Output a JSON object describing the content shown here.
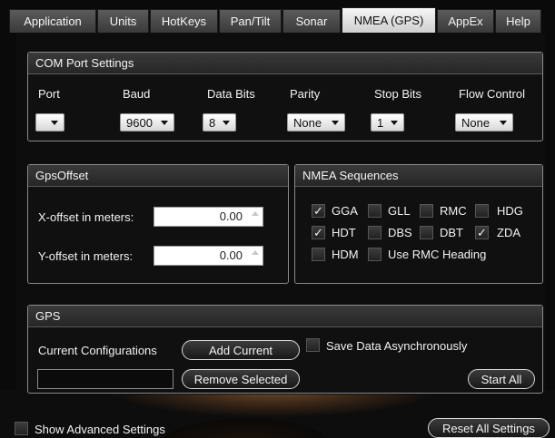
{
  "tabs": [
    {
      "label": "Application"
    },
    {
      "label": "Units"
    },
    {
      "label": "HotKeys"
    },
    {
      "label": "Pan/Tilt"
    },
    {
      "label": "Sonar"
    },
    {
      "label": "NMEA (GPS)",
      "active": true
    },
    {
      "label": "AppEx"
    },
    {
      "label": "Help"
    }
  ],
  "com": {
    "title": "COM Port Settings",
    "port_label": "Port",
    "port_value": "",
    "baud_label": "Baud",
    "baud_value": "9600",
    "databits_label": "Data Bits",
    "databits_value": "8",
    "parity_label": "Parity",
    "parity_value": "None",
    "stopbits_label": "Stop Bits",
    "stopbits_value": "1",
    "flow_label": "Flow Control",
    "flow_value": "None"
  },
  "offset": {
    "title": "GpsOffset",
    "x_label": "X-offset in meters:",
    "x_value": "0.00",
    "y_label": "Y-offset in meters:",
    "y_value": "0.00"
  },
  "nmea": {
    "title": "NMEA Sequences",
    "items": [
      {
        "label": "GGA",
        "checked": true
      },
      {
        "label": "GLL",
        "checked": false
      },
      {
        "label": "RMC",
        "checked": false
      },
      {
        "label": "HDG",
        "checked": false
      },
      {
        "label": "HDT",
        "checked": true
      },
      {
        "label": "DBS",
        "checked": false
      },
      {
        "label": "DBT",
        "checked": false
      },
      {
        "label": "ZDA",
        "checked": true
      },
      {
        "label": "HDM",
        "checked": false
      },
      {
        "label": "Use RMC Heading",
        "checked": false
      }
    ]
  },
  "gps": {
    "title": "GPS",
    "current_config_label": "Current Configurations",
    "add_current": "Add Current",
    "remove_selected": "Remove Selected",
    "save_async_label": "Save Data Asynchronously",
    "start_all": "Start All"
  },
  "footer": {
    "show_advanced": "Show Advanced Settings",
    "reset_all": "Reset All Settings"
  },
  "check_glyph": "✓"
}
